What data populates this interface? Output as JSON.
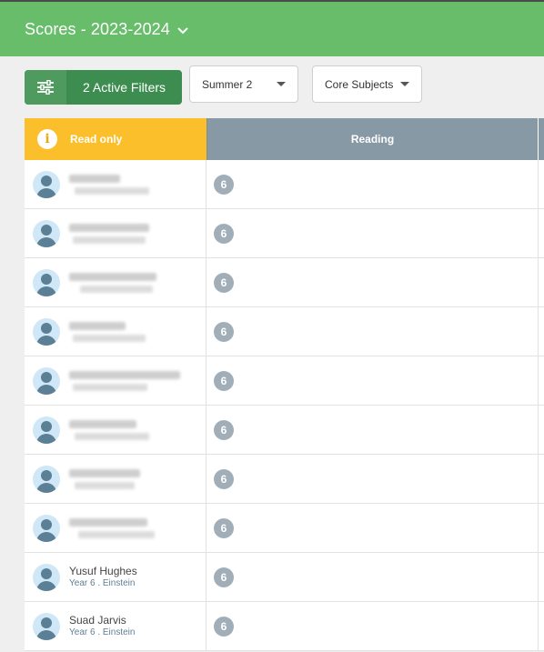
{
  "header": {
    "title": "Scores - 2023-2024",
    "accent": "#67bd6a"
  },
  "toolbar": {
    "filters_label": "2 Active Filters",
    "term_select": {
      "value": "Summer 2"
    },
    "subject_select": {
      "value": "Core Subjects"
    }
  },
  "grid": {
    "readonly_label": "Read only",
    "columns": [
      {
        "label": "Reading"
      }
    ],
    "rows": [
      {
        "name": "",
        "class": "",
        "redacted": true,
        "score": "6"
      },
      {
        "name": "",
        "class": "",
        "redacted": true,
        "score": "6"
      },
      {
        "name": "",
        "class": "",
        "redacted": true,
        "score": "6"
      },
      {
        "name": "",
        "class": "",
        "redacted": true,
        "score": "6"
      },
      {
        "name": "",
        "class": "",
        "redacted": true,
        "score": "6"
      },
      {
        "name": "",
        "class": "",
        "redacted": true,
        "score": "6"
      },
      {
        "name": "",
        "class": "",
        "redacted": true,
        "score": "6"
      },
      {
        "name": "",
        "class": "",
        "redacted": true,
        "score": "6"
      },
      {
        "name": "Yusuf Hughes",
        "class": "Year 6 . Einstein",
        "redacted": false,
        "score": "6"
      },
      {
        "name": "Suad Jarvis",
        "class": "Year 6 . Einstein",
        "redacted": false,
        "score": "6"
      }
    ]
  }
}
